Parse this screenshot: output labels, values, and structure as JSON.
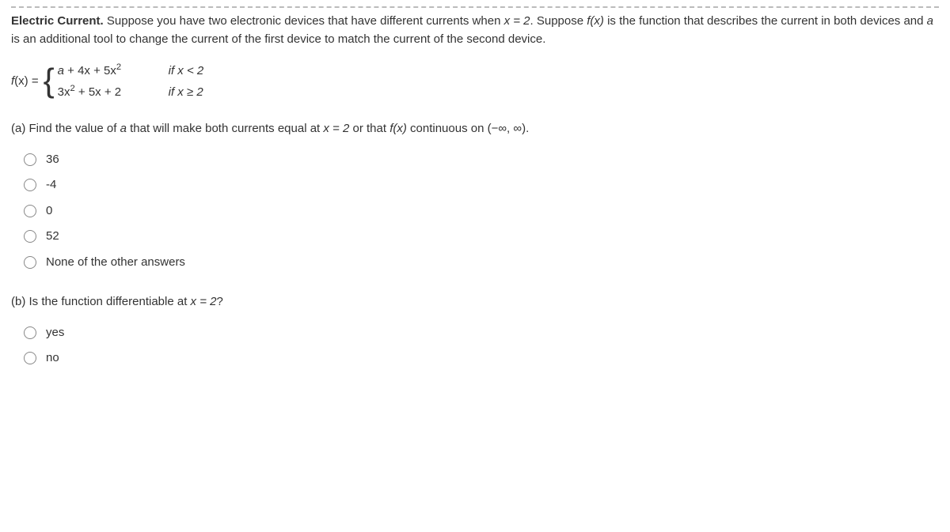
{
  "intro": {
    "title": "Electric Current.",
    "body_before_x": " Suppose you have two electronic devices that have different currents when ",
    "x_eq": "x = 2",
    "body_mid": ". Suppose ",
    "fx": "f(x)",
    "body_after_fx": " is the function that describes the current in both devices and ",
    "a_var": "a",
    "body_end": " is an additional tool to change the current of the first device to match the current of the second device."
  },
  "piecewise": {
    "lhs_pre": "f",
    "lhs_x": "(x) = ",
    "case1_a": "a",
    "case1_rest": " + 4x + 5x",
    "case1_exp": "2",
    "case1_cond_pre": "if x",
    "case1_cond_op": " < 2",
    "case2_pre": "3x",
    "case2_exp": "2",
    "case2_rest": " + 5x + 2",
    "case2_cond_pre": "if x",
    "case2_cond_op": " ≥ 2"
  },
  "partA": {
    "label": "(a) Find the value of ",
    "a_var": "a",
    "mid1": " that will make both currents equal at ",
    "x_eq": "x = 2",
    "mid2": " or that ",
    "fx": "f(x)",
    "tail": " continuous on (−∞, ∞).",
    "options": [
      "36",
      "-4",
      "0",
      "52",
      "None of the other answers"
    ]
  },
  "partB": {
    "label": "(b) Is the function differentiable at ",
    "x_eq": "x = 2",
    "tail": "?",
    "options": [
      "yes",
      "no"
    ]
  }
}
